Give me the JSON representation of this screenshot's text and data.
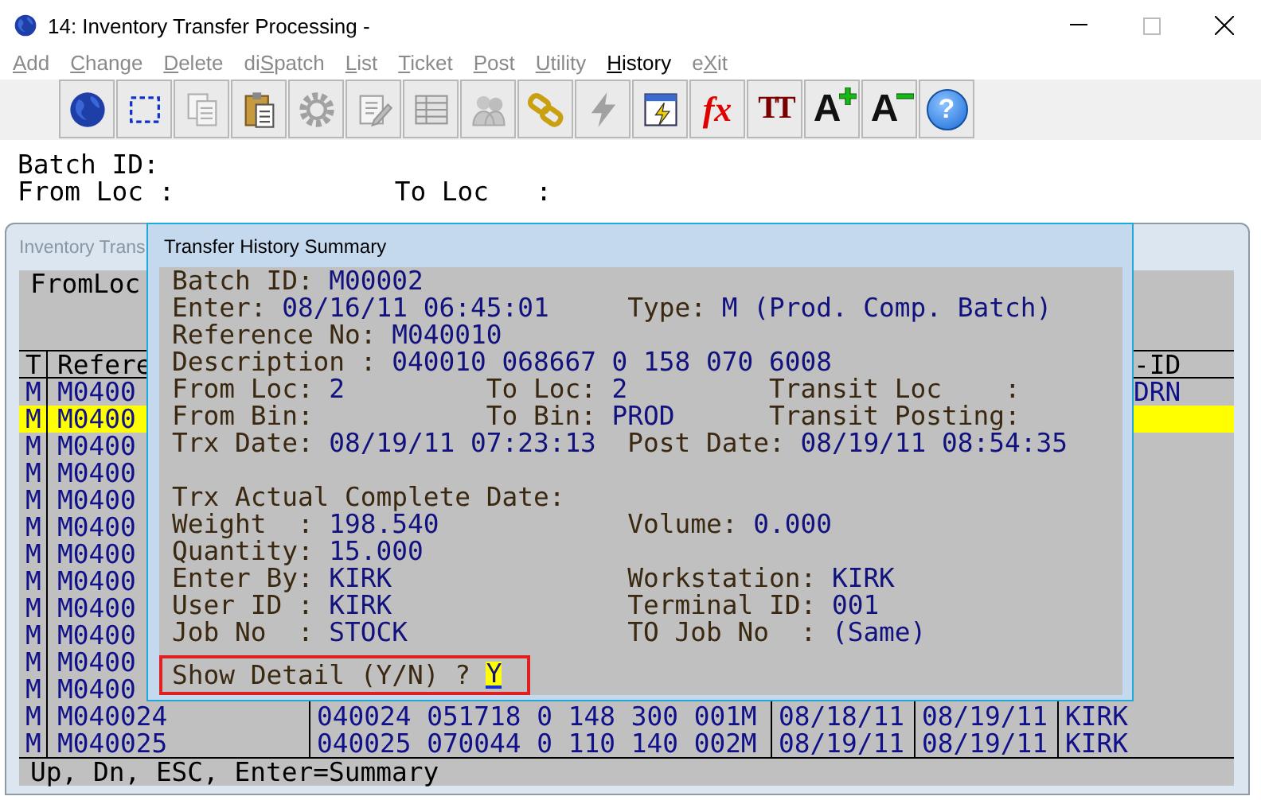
{
  "window": {
    "title": "14: Inventory Transfer Processing -"
  },
  "menu": [
    {
      "hotkey": "A",
      "after": "dd",
      "disabled": true
    },
    {
      "hotkey": "C",
      "after": "hange",
      "disabled": true
    },
    {
      "hotkey": "D",
      "after": "elete",
      "disabled": true
    },
    {
      "before": "di",
      "hotkey": "S",
      "after": "patch",
      "disabled": true
    },
    {
      "hotkey": "L",
      "after": "ist",
      "disabled": true
    },
    {
      "hotkey": "T",
      "after": "icket",
      "disabled": true
    },
    {
      "hotkey": "P",
      "after": "ost",
      "disabled": true
    },
    {
      "hotkey": "U",
      "after": "tility",
      "disabled": true
    },
    {
      "hotkey": "H",
      "after": "istory",
      "disabled": false
    },
    {
      "before": "e",
      "hotkey": "X",
      "after": "it",
      "disabled": true
    }
  ],
  "toolbar": [
    {
      "kind": "globe",
      "disabled": false
    },
    {
      "kind": "select",
      "disabled": false
    },
    {
      "kind": "copy",
      "disabled": true
    },
    {
      "kind": "paste",
      "disabled": false
    },
    {
      "kind": "gear",
      "disabled": true
    },
    {
      "kind": "edit",
      "disabled": true
    },
    {
      "kind": "table",
      "disabled": true
    },
    {
      "kind": "people",
      "disabled": true
    },
    {
      "kind": "link",
      "disabled": false
    },
    {
      "kind": "bolt",
      "disabled": true
    },
    {
      "kind": "calendar",
      "disabled": false
    },
    {
      "kind": "formula",
      "label": "fx",
      "disabled": false
    },
    {
      "kind": "font",
      "label": "TT",
      "disabled": false
    },
    {
      "kind": "grow",
      "label": "A",
      "disabled": false
    },
    {
      "kind": "shrink",
      "label": "A",
      "disabled": false
    },
    {
      "kind": "help",
      "label": "?",
      "disabled": false
    }
  ],
  "background_lines": [
    {
      "labels": [
        "Batch ID:"
      ]
    },
    {
      "labels": [
        "From Loc :",
        "To Loc   :"
      ]
    }
  ],
  "inner_window": {
    "title": "Inventory Trans",
    "from_loc_label": "FromLoc",
    "header": {
      "type": "T",
      "reference": "Refere",
      "column_6_end": "-ID"
    },
    "rows": [
      {
        "type": "M",
        "reference": "M0400",
        "selected": false,
        "column_6_end": "DRN"
      },
      {
        "type": "M",
        "reference": "M0400",
        "selected": true
      },
      {
        "type": "M",
        "reference": "M0400",
        "selected": false
      },
      {
        "type": "M",
        "reference": "M0400",
        "selected": false
      },
      {
        "type": "M",
        "reference": "M0400",
        "selected": false
      },
      {
        "type": "M",
        "reference": "M0400",
        "selected": false
      },
      {
        "type": "M",
        "reference": "M0400",
        "selected": false
      },
      {
        "type": "M",
        "reference": "M0400",
        "selected": false
      },
      {
        "type": "M",
        "reference": "M0400",
        "selected": false
      },
      {
        "type": "M",
        "reference": "M0400",
        "selected": false
      },
      {
        "type": "M",
        "reference": "M0400",
        "selected": false
      },
      {
        "type": "M",
        "reference": "M0400",
        "selected": false
      },
      {
        "type": "M",
        "reference": "M040024",
        "selected": false,
        "description": "040024 051718 0 148 300 001M",
        "column_4": "08/18/11",
        "column_5": "08/19/11",
        "column_6": "KIRK"
      },
      {
        "type": "M",
        "reference": "M040025",
        "selected": false,
        "description": "040025 070044 0 110 140 002M",
        "column_4": "08/19/11",
        "column_5": "08/19/11",
        "column_6": "KIRK"
      }
    ],
    "status": "Up, Dn, ESC, Enter=Summary"
  },
  "dialog": {
    "title": "Transfer History Summary",
    "sections": [
      {
        "lines": [
          {
            "fields": [
              {
                "label": "Batch ID:",
                "value": "M00002"
              }
            ]
          },
          {
            "fields": [
              {
                "label": "Enter:",
                "value": "08/16/11 06:45:01"
              },
              {
                "label": "Type:",
                "value": "M (Prod. Comp. Batch)"
              }
            ]
          },
          {
            "fields": [
              {
                "label": "Reference No:",
                "value": "M040010"
              }
            ]
          },
          {
            "fields": [
              {
                "label": "Description :",
                "value": "040010 068667 0 158 070 6008"
              }
            ]
          },
          {
            "fields": [
              {
                "label": "From Loc:",
                "value": "2"
              },
              {
                "label": "To Loc:",
                "value": "2"
              },
              {
                "label": "Transit Loc    :"
              }
            ]
          },
          {
            "fields": [
              {
                "label": "From Bin:"
              },
              {
                "label": "To Bin:",
                "value": "PROD"
              },
              {
                "label": "Transit Posting:"
              }
            ]
          },
          {
            "fields": [
              {
                "label": "Trx Date:",
                "value": "08/19/11 07:23:13"
              },
              {
                "label": "Post Date:",
                "value": "08/19/11 08:54:35"
              }
            ]
          }
        ]
      },
      {
        "lines": [
          {
            "fields": [
              {
                "label": "Trx Actual Complete Date:"
              }
            ]
          },
          {
            "fields": [
              {
                "label": "Weight  :",
                "value": "198.540"
              },
              {
                "label": "Volume:",
                "value": "0.000"
              }
            ]
          },
          {
            "fields": [
              {
                "label": "Quantity:",
                "value": "15.000"
              }
            ]
          },
          {
            "fields": [
              {
                "label": "Enter By:",
                "value": "KIRK"
              },
              {
                "label": "Workstation:",
                "value": "KIRK"
              }
            ]
          },
          {
            "fields": [
              {
                "label": "User ID :",
                "value": "KIRK"
              },
              {
                "label": "Terminal ID:",
                "value": "001"
              }
            ]
          },
          {
            "fields": [
              {
                "label": "Job No  :",
                "value": "STOCK"
              },
              {
                "label": "TO Job No  :",
                "value": "(Same)"
              }
            ]
          }
        ]
      }
    ],
    "prompt": {
      "label": "Show Detail (Y/N) ?",
      "value": "Y"
    }
  }
}
